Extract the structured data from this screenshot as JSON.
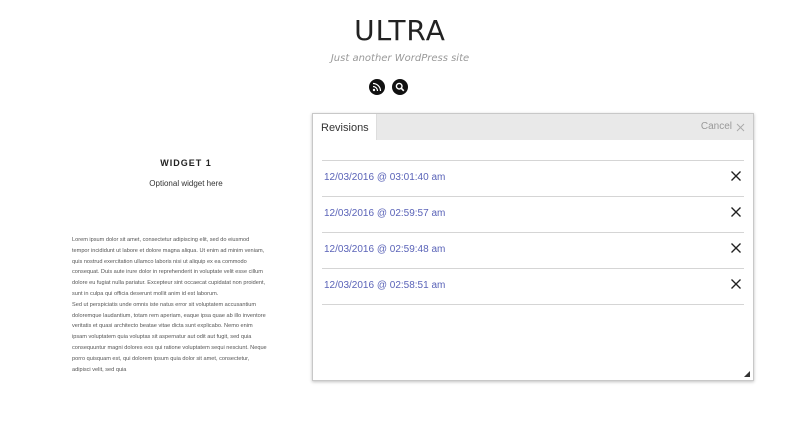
{
  "site": {
    "title": "ULTRA",
    "description": "Just another WordPress site"
  },
  "header_icons": [
    "rss-icon",
    "search-icon"
  ],
  "widget": {
    "title": "WIDGET 1",
    "subtitle": "Optional widget here"
  },
  "lorem": {
    "p1": "Lorem ipsum dolor sit amet, consectetur adipiscing elit, sed do eiusmod tempor incididunt ut labore et dolore magna aliqua. Ut enim ad minim veniam, quis nostrud exercitation ullamco laboris nisi ut aliquip ex ea commodo consequat. Duis aute irure dolor in reprehenderit in voluptate velit esse cillum dolore eu fugiat nulla pariatur. Excepteur sint occaecat cupidatat non proident, sunt in culpa qui officia deserunt mollit anim id est laborum.",
    "p2": "Sed ut perspiciatis unde omnis iste natus error sit voluptatem accusantium doloremque laudantium, totam rem aperiam, eaque ipsa quae ab illo inventore veritatis et quasi architecto beatae vitae dicta sunt explicabo. Nemo enim ipsam voluptatem quia voluptas sit aspernatur aut odit aut fugit, sed quia consequuntur magni dolores eos qui ratione voluptatem sequi nesciunt. Neque porro quisquam est, qui dolorem ipsum quia dolor sit amet, consectetur, adipisci velit, sed quia"
  },
  "panel": {
    "tab_label": "Revisions",
    "cancel_label": "Cancel",
    "revisions": [
      {
        "label": "12/03/2016 @ 03:01:40 am"
      },
      {
        "label": "12/03/2016 @ 02:59:57 am"
      },
      {
        "label": "12/03/2016 @ 02:59:48 am"
      },
      {
        "label": "12/03/2016 @ 02:58:51 am"
      }
    ]
  },
  "colors": {
    "link": "#5a63b8",
    "header_bg": "#e9e9e9"
  }
}
